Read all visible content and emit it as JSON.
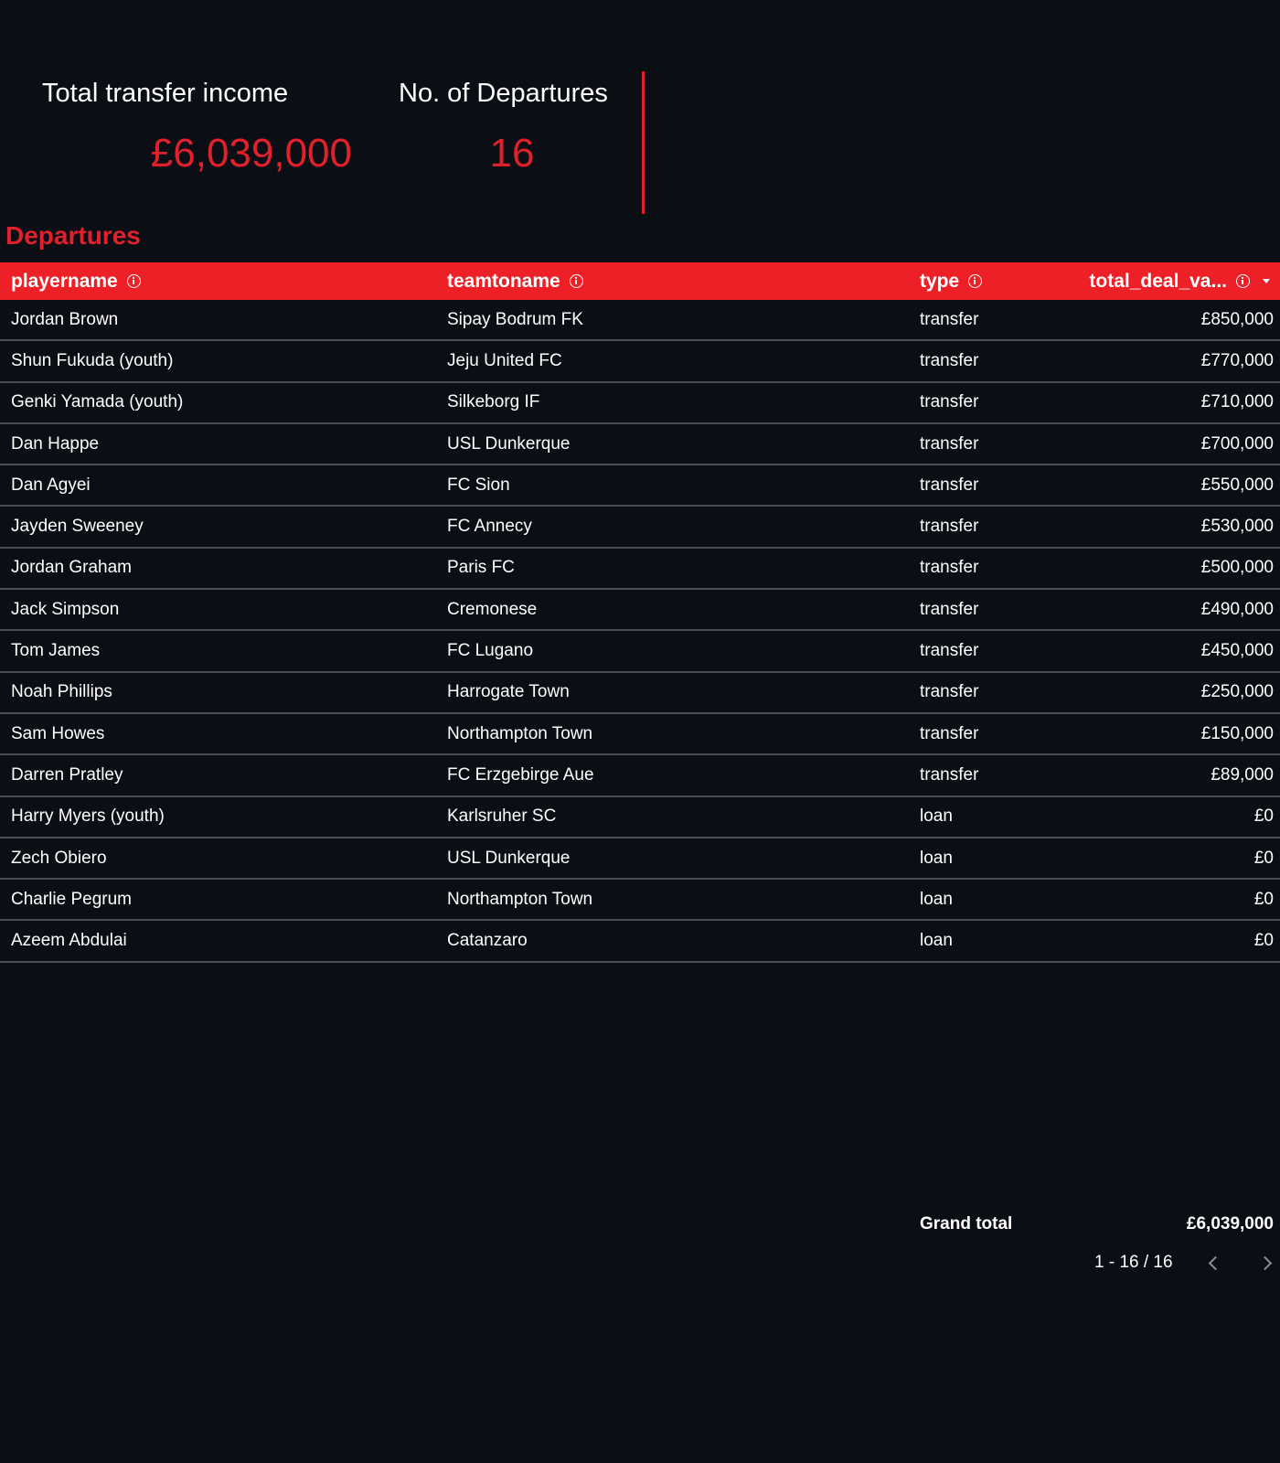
{
  "kpis": {
    "income_label": "Total transfer income",
    "income_value": "£6,039,000",
    "departures_label": "No. of Departures",
    "departures_value": "16"
  },
  "section_title": "Departures",
  "table": {
    "headers": {
      "player": "playername",
      "team": "teamtoname",
      "type": "type",
      "value": "total_deal_va..."
    },
    "rows": [
      {
        "player": "Jordan Brown",
        "team": "Sipay Bodrum FK",
        "type": "transfer",
        "value": "£850,000"
      },
      {
        "player": "Shun Fukuda (youth)",
        "team": "Jeju United FC",
        "type": "transfer",
        "value": "£770,000"
      },
      {
        "player": "Genki Yamada (youth)",
        "team": "Silkeborg IF",
        "type": "transfer",
        "value": "£710,000"
      },
      {
        "player": "Dan Happe",
        "team": "USL Dunkerque",
        "type": "transfer",
        "value": "£700,000"
      },
      {
        "player": "Dan Agyei",
        "team": "FC Sion",
        "type": "transfer",
        "value": "£550,000"
      },
      {
        "player": "Jayden Sweeney",
        "team": "FC Annecy",
        "type": "transfer",
        "value": "£530,000"
      },
      {
        "player": "Jordan Graham",
        "team": "Paris FC",
        "type": "transfer",
        "value": "£500,000"
      },
      {
        "player": "Jack Simpson",
        "team": "Cremonese",
        "type": "transfer",
        "value": "£490,000"
      },
      {
        "player": "Tom James",
        "team": "FC Lugano",
        "type": "transfer",
        "value": "£450,000"
      },
      {
        "player": "Noah Phillips",
        "team": "Harrogate Town",
        "type": "transfer",
        "value": "£250,000"
      },
      {
        "player": "Sam Howes",
        "team": "Northampton Town",
        "type": "transfer",
        "value": "£150,000"
      },
      {
        "player": "Darren Pratley",
        "team": "FC Erzgebirge Aue",
        "type": "transfer",
        "value": "£89,000"
      },
      {
        "player": "Harry Myers (youth)",
        "team": "Karlsruher SC",
        "type": "loan",
        "value": "£0"
      },
      {
        "player": "Zech Obiero",
        "team": "USL Dunkerque",
        "type": "loan",
        "value": "£0"
      },
      {
        "player": "Charlie Pegrum",
        "team": "Northampton Town",
        "type": "loan",
        "value": "£0"
      },
      {
        "player": "Azeem Abdulai",
        "team": "Catanzaro",
        "type": "loan",
        "value": "£0"
      }
    ],
    "grand_total_label": "Grand total",
    "grand_total_value": "£6,039,000"
  },
  "pager": {
    "range_text": "1 - 16 / 16"
  },
  "colors": {
    "background": "#0b0e14",
    "accent": "#ed1f27",
    "kpi_value": "#e0202b"
  },
  "icons": {
    "header_info": "info-icon",
    "sort": "sort-descending-icon",
    "prev": "chevron-left-icon",
    "next": "chevron-right-icon"
  }
}
